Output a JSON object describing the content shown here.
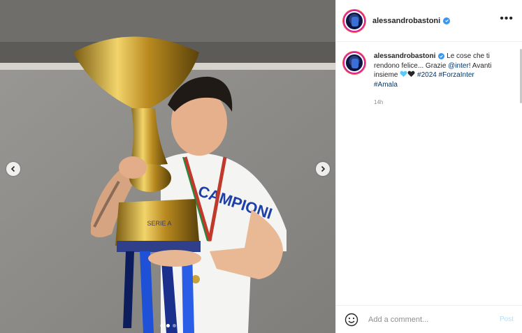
{
  "post": {
    "username": "alessandrobastoni",
    "verified": true,
    "more_label": "•••"
  },
  "media": {
    "shirt_text": "CAMPIONI",
    "trophy_text": "SERIE A",
    "carousel_count": 3,
    "carousel_active": 2
  },
  "caption": {
    "username": "alessandrobastoni",
    "text_1": " Le cose che ti rendono felice... Grazie ",
    "mention": "@inter",
    "text_2": "! Avanti insieme ",
    "hashtag_1": "#2024",
    "hashtag_2": "#ForzaInter",
    "hashtag_3": "#Amala",
    "time": "14h",
    "heart_colors": [
      "#5ac8fa",
      "#262626"
    ]
  },
  "footer": {
    "placeholder": "Add a comment...",
    "post_label": "Post"
  },
  "colors": {
    "link": "#00376b",
    "verified": "#3897f0",
    "post_disabled": "#b2dffc"
  }
}
